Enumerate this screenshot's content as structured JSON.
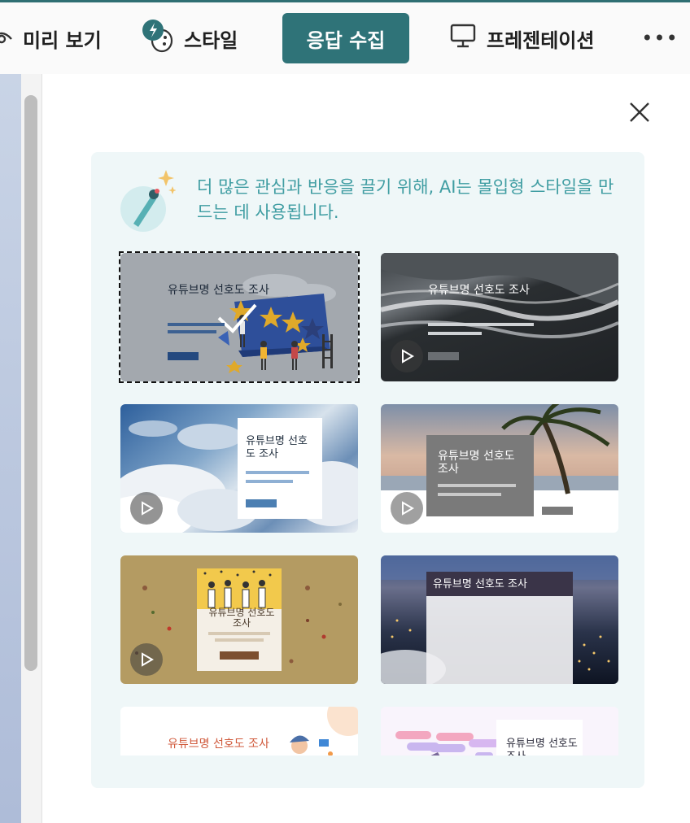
{
  "toolbar": {
    "preview_label": "미리 보기",
    "style_label": "스타일",
    "collect_label": "응답 수집",
    "present_label": "프레젠테이션",
    "more_label": "•••",
    "active_color": "#2f7378"
  },
  "style_panel": {
    "ai_message": "더 많은 관심과 반응을 끌기 위해, AI는 몰입형 스타일을 만드는 데 사용됩니다.",
    "accent_color": "#3f9da2",
    "themes": [
      {
        "title": "유튜브명 선호도 조사",
        "selected": true,
        "has_video": false
      },
      {
        "title": "유튜브명 선호도 조사",
        "selected": false,
        "has_video": true
      },
      {
        "title": "유튜브명 선호도 조사",
        "selected": false,
        "has_video": true
      },
      {
        "title": "유튜브명 선호도 조사",
        "selected": false,
        "has_video": true
      },
      {
        "title": "유튜브명 선호도 조사",
        "selected": false,
        "has_video": true
      },
      {
        "title": "유튜브명 선호도 조사",
        "selected": false,
        "has_video": false
      },
      {
        "title": "유튜브명 선호도 조사",
        "selected": false,
        "has_video": false
      },
      {
        "title": "유튜브명 선호도 조사",
        "selected": false,
        "has_video": false
      }
    ]
  }
}
